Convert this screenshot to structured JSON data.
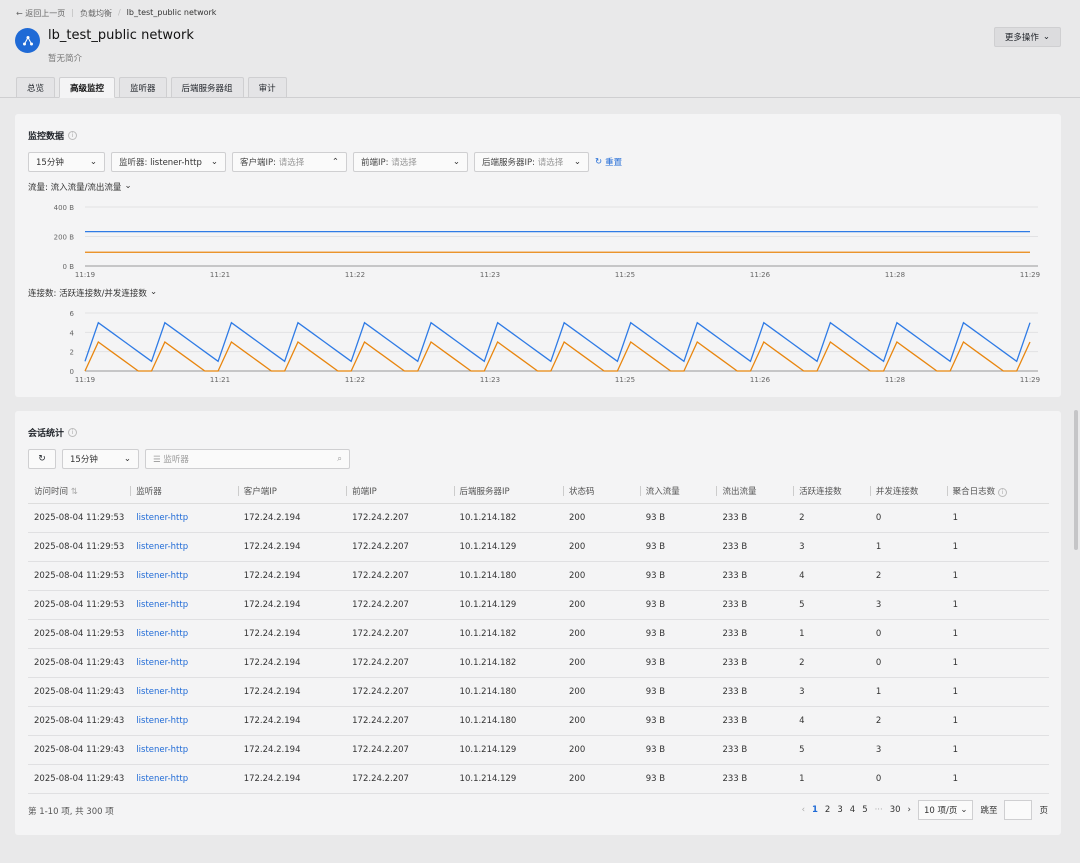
{
  "breadcrumb": {
    "back": "返回上一页",
    "parent": "负载均衡",
    "current": "lb_test_public network"
  },
  "header": {
    "title": "lb_test_public network",
    "subtitle": "暂无简介",
    "more_label": "更多操作"
  },
  "tabs": [
    "总览",
    "高级监控",
    "监听器",
    "后端服务器组",
    "审计"
  ],
  "monitor": {
    "title": "监控数据",
    "filters": {
      "time": "15分钟",
      "listener_label": "监听器:",
      "listener_value": "listener-http",
      "client_ip_label": "客户端IP:",
      "client_ip_placeholder": "请选择",
      "front_ip_label": "前端IP:",
      "front_ip_placeholder": "请选择",
      "backend_ip_label": "后端服务器IP:",
      "backend_ip_placeholder": "请选择",
      "reset_label": "重置"
    },
    "traffic_label": "流量:  流入流量/流出流量",
    "conn_label": "连接数:  活跃连接数/并发连接数"
  },
  "chart_data": [
    {
      "type": "line",
      "title": "流量:  流入流量/流出流量",
      "x": [
        "11:19",
        "11:21",
        "11:22",
        "11:23",
        "11:25",
        "11:26",
        "11:28",
        "11:29"
      ],
      "y_ticks": [
        "0 B",
        "200 B",
        "400 B"
      ],
      "ylim": [
        0,
        400
      ],
      "grid": true,
      "series": [
        {
          "color": "#2f7be5",
          "values": [
            233,
            233,
            233,
            233,
            233,
            233,
            233,
            233
          ]
        },
        {
          "color": "#e8860f",
          "values": [
            93,
            93,
            93,
            93,
            93,
            93,
            93,
            93
          ]
        }
      ]
    },
    {
      "type": "line",
      "title": "连接数:  活跃连接数/并发连接数",
      "x": [
        "11:19",
        "11:21",
        "11:22",
        "11:23",
        "11:25",
        "11:26",
        "11:28",
        "11:29"
      ],
      "y_ticks": [
        "0",
        "2",
        "4",
        "6"
      ],
      "ylim": [
        0,
        6
      ],
      "grid": true,
      "series": [
        {
          "color": "#2f7be5",
          "values": [
            1,
            5,
            4,
            3,
            2,
            1,
            5,
            4,
            3,
            2,
            1,
            5,
            4,
            3,
            2,
            1,
            5,
            4,
            3,
            2,
            1,
            5,
            4,
            3,
            2,
            1,
            5,
            4,
            3,
            2,
            1,
            5,
            4,
            3,
            2,
            1,
            5,
            4,
            3,
            2,
            1,
            5,
            4,
            3,
            2,
            1,
            5,
            4,
            3,
            2,
            1,
            5,
            4,
            3,
            2,
            1,
            5,
            4,
            3,
            2,
            1,
            5,
            4,
            3,
            2,
            1,
            5,
            4,
            3,
            2,
            1,
            5
          ]
        },
        {
          "color": "#e8860f",
          "values": [
            0,
            3,
            2,
            1,
            0,
            0,
            3,
            2,
            1,
            0,
            0,
            3,
            2,
            1,
            0,
            0,
            3,
            2,
            1,
            0,
            0,
            3,
            2,
            1,
            0,
            0,
            3,
            2,
            1,
            0,
            0,
            3,
            2,
            1,
            0,
            0,
            3,
            2,
            1,
            0,
            0,
            3,
            2,
            1,
            0,
            0,
            3,
            2,
            1,
            0,
            0,
            3,
            2,
            1,
            0,
            0,
            3,
            2,
            1,
            0,
            0,
            3,
            2,
            1,
            0,
            0,
            3,
            2,
            1,
            0,
            0,
            3
          ]
        }
      ]
    }
  ],
  "session": {
    "title": "会话统计",
    "time": "15分钟",
    "search_placeholder": "监听器",
    "columns": [
      "访问时间",
      "监听器",
      "客户端IP",
      "前端IP",
      "后端服务器IP",
      "状态码",
      "流入流量",
      "流出流量",
      "活跃连接数",
      "并发连接数",
      "聚合日志数"
    ],
    "rows": [
      [
        "2025-08-04 11:29:53",
        "listener-http",
        "172.24.2.194",
        "172.24.2.207",
        "10.1.214.182",
        "200",
        "93 B",
        "233 B",
        "2",
        "0",
        "1"
      ],
      [
        "2025-08-04 11:29:53",
        "listener-http",
        "172.24.2.194",
        "172.24.2.207",
        "10.1.214.129",
        "200",
        "93 B",
        "233 B",
        "3",
        "1",
        "1"
      ],
      [
        "2025-08-04 11:29:53",
        "listener-http",
        "172.24.2.194",
        "172.24.2.207",
        "10.1.214.180",
        "200",
        "93 B",
        "233 B",
        "4",
        "2",
        "1"
      ],
      [
        "2025-08-04 11:29:53",
        "listener-http",
        "172.24.2.194",
        "172.24.2.207",
        "10.1.214.129",
        "200",
        "93 B",
        "233 B",
        "5",
        "3",
        "1"
      ],
      [
        "2025-08-04 11:29:53",
        "listener-http",
        "172.24.2.194",
        "172.24.2.207",
        "10.1.214.182",
        "200",
        "93 B",
        "233 B",
        "1",
        "0",
        "1"
      ],
      [
        "2025-08-04 11:29:43",
        "listener-http",
        "172.24.2.194",
        "172.24.2.207",
        "10.1.214.182",
        "200",
        "93 B",
        "233 B",
        "2",
        "0",
        "1"
      ],
      [
        "2025-08-04 11:29:43",
        "listener-http",
        "172.24.2.194",
        "172.24.2.207",
        "10.1.214.180",
        "200",
        "93 B",
        "233 B",
        "3",
        "1",
        "1"
      ],
      [
        "2025-08-04 11:29:43",
        "listener-http",
        "172.24.2.194",
        "172.24.2.207",
        "10.1.214.180",
        "200",
        "93 B",
        "233 B",
        "4",
        "2",
        "1"
      ],
      [
        "2025-08-04 11:29:43",
        "listener-http",
        "172.24.2.194",
        "172.24.2.207",
        "10.1.214.129",
        "200",
        "93 B",
        "233 B",
        "5",
        "3",
        "1"
      ],
      [
        "2025-08-04 11:29:43",
        "listener-http",
        "172.24.2.194",
        "172.24.2.207",
        "10.1.214.129",
        "200",
        "93 B",
        "233 B",
        "1",
        "0",
        "1"
      ]
    ],
    "total_text": "第 1-10 项, 共 300 项",
    "pages": [
      "1",
      "2",
      "3",
      "4",
      "5",
      "···",
      "30"
    ],
    "page_size": "10 项/页",
    "jump_label": "跳至",
    "page_unit": "页"
  }
}
